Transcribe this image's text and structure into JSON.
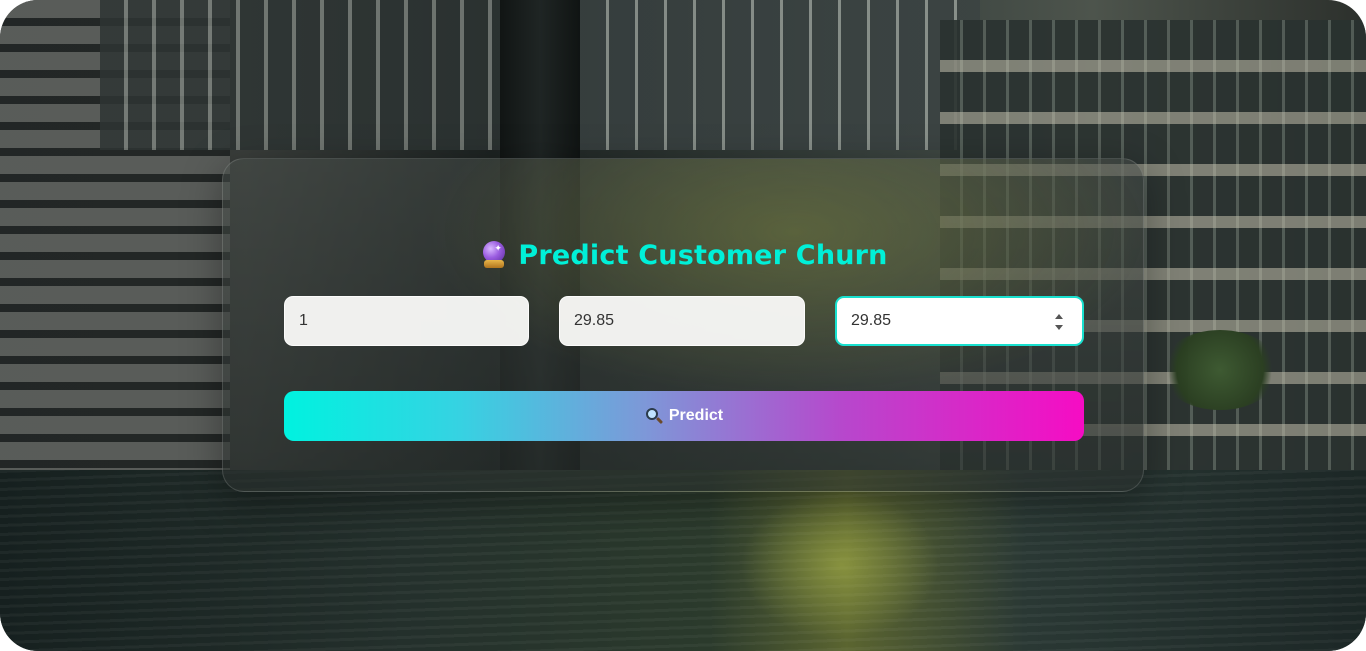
{
  "form": {
    "title": "Predict Customer Churn",
    "title_icon": "crystal-ball-icon",
    "fields": [
      {
        "value": "1"
      },
      {
        "value": "29.85"
      },
      {
        "value": "29.85"
      }
    ],
    "predict_button": {
      "label": "Predict",
      "icon": "magnifier-icon"
    }
  },
  "colors": {
    "title": "#00f0d8",
    "button_gradient_start": "#00f2e0",
    "button_gradient_end": "#f60cc4",
    "focus_border": "#19e0cf"
  }
}
